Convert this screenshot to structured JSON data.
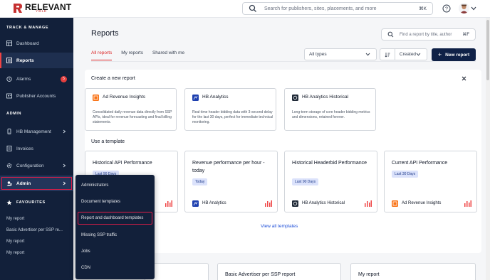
{
  "topbar": {
    "logo_text": "RELEVANT",
    "logo_sub": "YIELD",
    "search_placeholder": "Search for publishers, sites, placements, and more",
    "search_shortcut": "⌘K"
  },
  "sidebar": {
    "section_track": "TRACK & MANAGE",
    "items_track": [
      {
        "label": "Dashboard",
        "icon": "dashboard-icon"
      },
      {
        "label": "Reports",
        "icon": "reports-icon"
      },
      {
        "label": "Alarms",
        "icon": "alarm-icon",
        "badge": "5"
      },
      {
        "label": "Publisher Accounts",
        "icon": "publisher-accounts-icon"
      }
    ],
    "section_admin": "ADMIN",
    "items_admin": [
      {
        "label": "HB Management",
        "icon": "hb-management-icon"
      },
      {
        "label": "Invoices",
        "icon": "invoices-icon"
      },
      {
        "label": "Configuration",
        "icon": "configuration-icon"
      },
      {
        "label": "Admin",
        "icon": "admin-icon"
      }
    ],
    "section_favourites": "FAVOURITES",
    "favourites": [
      "My report",
      "Basic Advertiser per SSP re...",
      "My report",
      "My report"
    ]
  },
  "admin_menu": {
    "items": [
      "Administrators",
      "Document templates",
      "Report and dashboard templates",
      "Missing SSP traffic",
      "Jobs",
      "CDN"
    ]
  },
  "main": {
    "title": "Reports",
    "find_placeholder": "Find a report by title, author",
    "find_shortcut": "⌘F",
    "tabs": [
      "All reports",
      "My reports",
      "Shared with me"
    ],
    "type_filter": "All types",
    "sort_label": "Created",
    "new_report_label": "New report",
    "create_title": "Create a new report",
    "create_cards": [
      {
        "name": "Ad Revenue Insights",
        "icon": "ad-revenue-icon",
        "desc": "Consolidated daily revenue data directly from SSP APIs, ideal for revenue forecasting and final billing statements."
      },
      {
        "name": "HB Analytics",
        "icon": "hb-analytics-icon",
        "desc": "Real-time header bidding data with 3-second delay for the last 30 days, perfect for immediate technical monitoring."
      },
      {
        "name": "HB Analytics Historical",
        "icon": "hb-historical-icon",
        "desc": "Long-term storage of core header bidding metrics and dimensions, retained forever."
      }
    ],
    "template_title": "Use a template",
    "templates": [
      {
        "title": "Historical API Performance",
        "badge": "Last 90 Days",
        "source": ""
      },
      {
        "title": "Revenue performance per hour - today",
        "badge": "Today",
        "source": "HB Analytics"
      },
      {
        "title": "Historical Headerbid Performance",
        "badge": "Last 90 Days",
        "source": "HB Analytics Historical"
      },
      {
        "title": "Current API Performance",
        "badge": "Last 30 Days",
        "source": "Ad Revenue Insights"
      }
    ],
    "view_all": "View all templates",
    "bottom_cards": [
      "Basic Advertiser per SSP report",
      "My report"
    ]
  },
  "colors": {
    "sidebar_bg": "#12203a",
    "accent_red": "#dc2626",
    "primary_button": "#0f2147",
    "badge_bg": "#dbe2fb"
  }
}
